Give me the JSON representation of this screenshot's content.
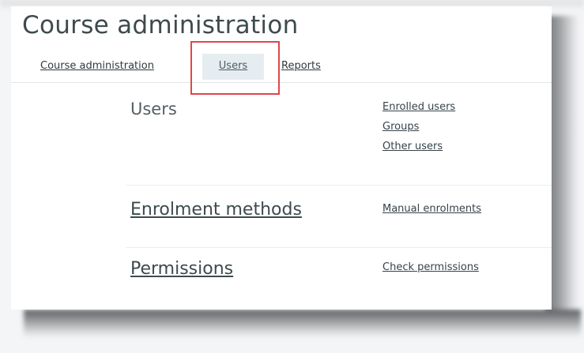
{
  "page": {
    "title": "Course administration"
  },
  "tabs": [
    {
      "label": "Course administration",
      "active": false
    },
    {
      "label": "Users",
      "active": true
    },
    {
      "label": "Reports",
      "active": false
    }
  ],
  "sections": {
    "users": {
      "heading": "Users",
      "links": [
        "Enrolled users",
        "Groups",
        "Other users"
      ]
    },
    "enrolment": {
      "heading": "Enrolment methods",
      "links": [
        "Manual enrolments"
      ]
    },
    "permissions": {
      "heading": "Permissions",
      "links": [
        "Check permissions"
      ]
    }
  },
  "colors": {
    "highlight": "#e0464d",
    "active_tab_bg": "#e6edf1"
  }
}
